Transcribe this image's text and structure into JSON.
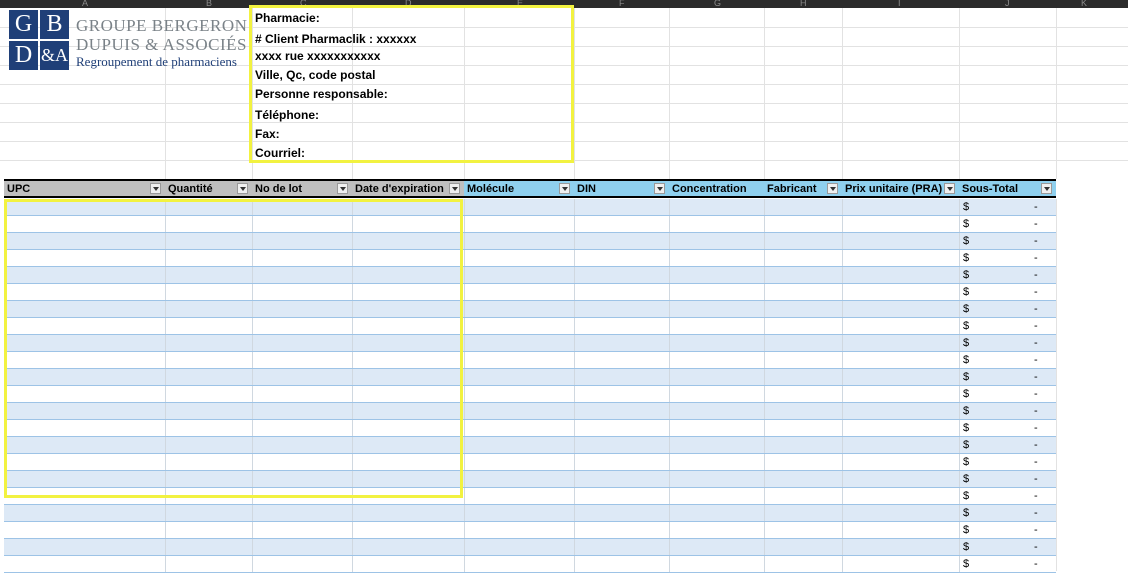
{
  "column_letters": [
    "A",
    "B",
    "C",
    "D",
    "E",
    "F",
    "G",
    "H",
    "I",
    "J",
    "K"
  ],
  "logo": {
    "initials": [
      "G",
      "B",
      "D",
      "&A"
    ],
    "line1": "GROUPE BERGERON",
    "line2": "DUPUIS & ASSOCIÉS",
    "line3": "Regroupement de pharmaciens",
    "colors": {
      "navy": "#1f3f78",
      "gray": "#7a8288"
    }
  },
  "info": {
    "pharmacie": "Pharmacie:",
    "client": "# Client Pharmaclik : xxxxxx",
    "rue": "xxxx rue xxxxxxxxxxx",
    "ville": "Ville, Qc, code postal",
    "personne": "Personne responsable:",
    "telephone": "Téléphone:",
    "fax": "Fax:",
    "courriel": "Courriel:"
  },
  "table": {
    "headers": [
      "UPC",
      "Quantité",
      "No de lot",
      "Date d'expiration",
      "Molécule",
      "DIN",
      "Concentration",
      "Fabricant",
      "Prix unitaire (PRA)",
      "Sous-Total"
    ],
    "header_colors": {
      "gray": "#bfbfbf",
      "blue": "#8fd0ee"
    },
    "row_count": 22,
    "subtotal_currency": "$",
    "subtotal_value": "-"
  },
  "highlight_color": "#f2f240"
}
